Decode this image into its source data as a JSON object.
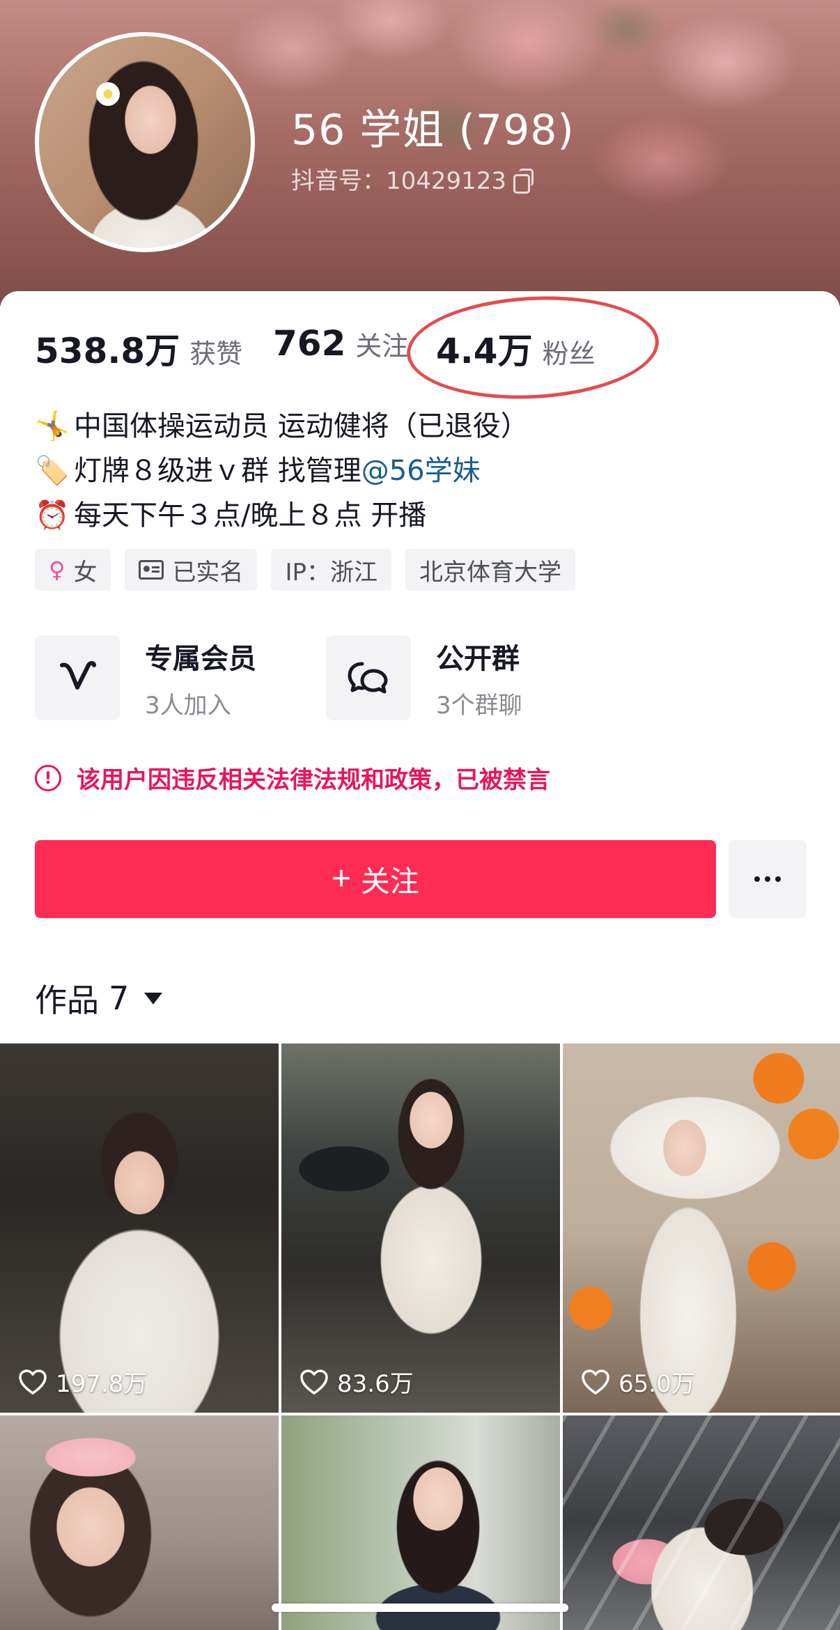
{
  "profile": {
    "nickname": "56 学姐 (798)",
    "douyin_id": "抖音号：10429123"
  },
  "stats": {
    "likes_value": "538.8万",
    "likes_label": "获赞",
    "following_value": "762",
    "following_label": "关注",
    "fans_value": "4.4万",
    "fans_label": "粉丝",
    "highlight_color": "#e24d4d"
  },
  "bio": {
    "line1_emoji": "🤸",
    "line1": "中国体操运动员 运动健将（已退役）",
    "line2_emoji": "🏷️",
    "line2": "灯牌８级进ｖ群 找管理 ",
    "line2_mention": "@56学妹",
    "line3_emoji": "⏰",
    "line3": "每天下午３点/晚上８点 开播"
  },
  "tags": {
    "gender": "女",
    "verified": "已实名",
    "ip": "IP：浙江",
    "school": "北京体育大学"
  },
  "features": {
    "member_title": "专属会员",
    "member_sub": "3人加入",
    "group_title": "公开群",
    "group_sub": "3个群聊"
  },
  "warning": {
    "text": "该用户因违反相关法律法规和政策，已被禁言",
    "color": "#e8155a"
  },
  "actions": {
    "follow_label": "关注",
    "accent_color": "#fe2c55"
  },
  "works": {
    "tab_label": "作品",
    "count": "7"
  },
  "videos": [
    {
      "likes": "197.8万"
    },
    {
      "likes": "83.6万"
    },
    {
      "likes": "65.0万"
    }
  ]
}
